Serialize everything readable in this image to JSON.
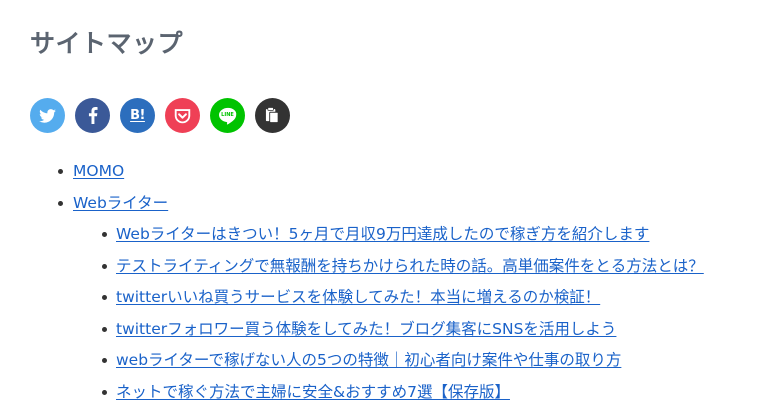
{
  "page": {
    "title": "サイトマップ"
  },
  "share": [
    {
      "name": "twitter-share-button",
      "icon": "twitter-icon",
      "color": "#55acee"
    },
    {
      "name": "facebook-share-button",
      "icon": "facebook-icon",
      "color": "#3b5998"
    },
    {
      "name": "hatena-share-button",
      "icon": "hatena-bookmark-icon",
      "label": "B!",
      "color": "#2c6ebd"
    },
    {
      "name": "pocket-share-button",
      "icon": "pocket-icon",
      "color": "#ef4056"
    },
    {
      "name": "line-share-button",
      "icon": "line-icon",
      "label": "LINE",
      "color": "#00c300"
    },
    {
      "name": "copy-share-button",
      "icon": "copy-icon",
      "color": "#333333"
    }
  ],
  "sitemap": {
    "categories": [
      {
        "label": "MOMO"
      },
      {
        "label": "Webライター"
      }
    ],
    "posts": [
      {
        "label": "Webライターはきつい！5ヶ月で月収9万円達成したので稼ぎ方を紹介します"
      },
      {
        "label": "テストライティングで無報酬を持ちかけられた時の話。高単価案件をとる方法とは？"
      },
      {
        "label": "twitterいいね買うサービスを体験してみた！本当に増えるのか検証！"
      },
      {
        "label": "twitterフォロワー買う体験をしてみた！ブログ集客にSNSを活用しよう"
      },
      {
        "label": "webライターで稼げない人の5つの特徴｜初心者向け案件や仕事の取り方"
      },
      {
        "label": "ネットで稼ぐ方法で主婦に安全&おすすめ7選【保存版】"
      }
    ]
  }
}
